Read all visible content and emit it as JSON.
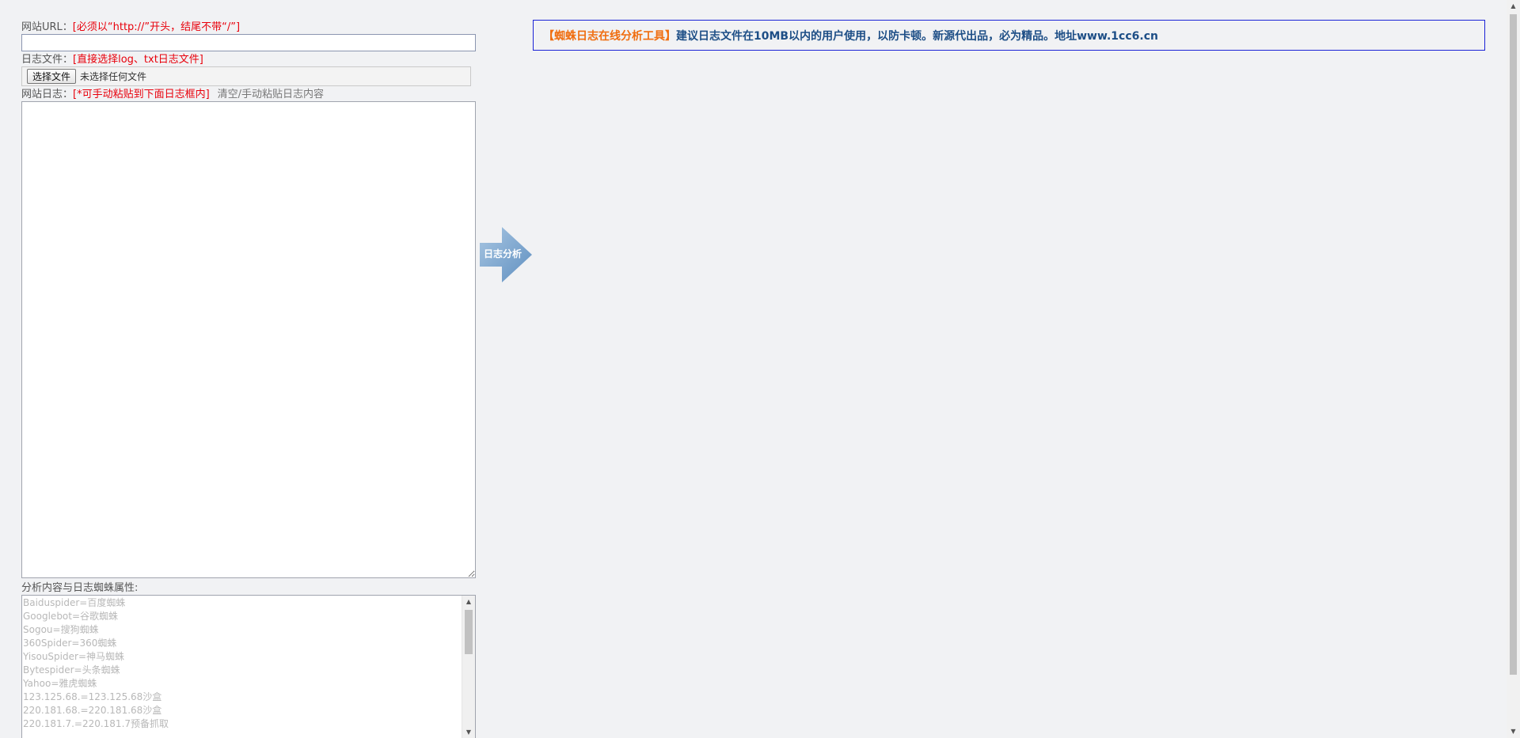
{
  "form": {
    "url_label": "网站URL：",
    "url_note": "[必须以“http://”开头，结尾不带“/”]",
    "url_value": "",
    "file_label": "日志文件：",
    "file_note": "[直接选择log、txt日志文件]",
    "file_button": "选择文件",
    "file_status": "未选择任何文件",
    "log_label": "网站日志：",
    "log_note": "[*可手动粘贴到下面日志框内]",
    "clear_link": "清空/手动粘贴日志内容",
    "log_value": "",
    "spider_label": "分析内容与日志蜘蛛属性:",
    "spider_lines": [
      "Baiduspider=百度蜘蛛",
      "Googlebot=谷歌蜘蛛",
      "Sogou=搜狗蜘蛛",
      "360Spider=360蜘蛛",
      "YisouSpider=神马蜘蛛",
      "Bytespider=头条蜘蛛",
      "Yahoo=雅虎蜘蛛",
      "123.125.68.=123.125.68沙盒",
      "220.181.68.=220.181.68沙盒",
      "220.181.7.=220.181.7预备抓取"
    ]
  },
  "analyze_button": {
    "label": "日志分析"
  },
  "notice": {
    "title": "【蜘蛛日志在线分析工具】",
    "text": "建议日志文件在10MB以内的用户使用，以防卡顿。新源代出品，必为精品。地址www.1cc6.cn"
  },
  "colors": {
    "background": "#f1f2f4",
    "note_red": "#e8000b",
    "notice_orange": "#f06d0f",
    "notice_blue": "#1d4e86",
    "notice_border": "#1a22d6",
    "arrow_blue": "#7aa4cc"
  },
  "icons": {
    "analyze": "arrow-right-icon",
    "scroll_up": "triangle-up-icon",
    "scroll_down": "triangle-down-icon"
  }
}
